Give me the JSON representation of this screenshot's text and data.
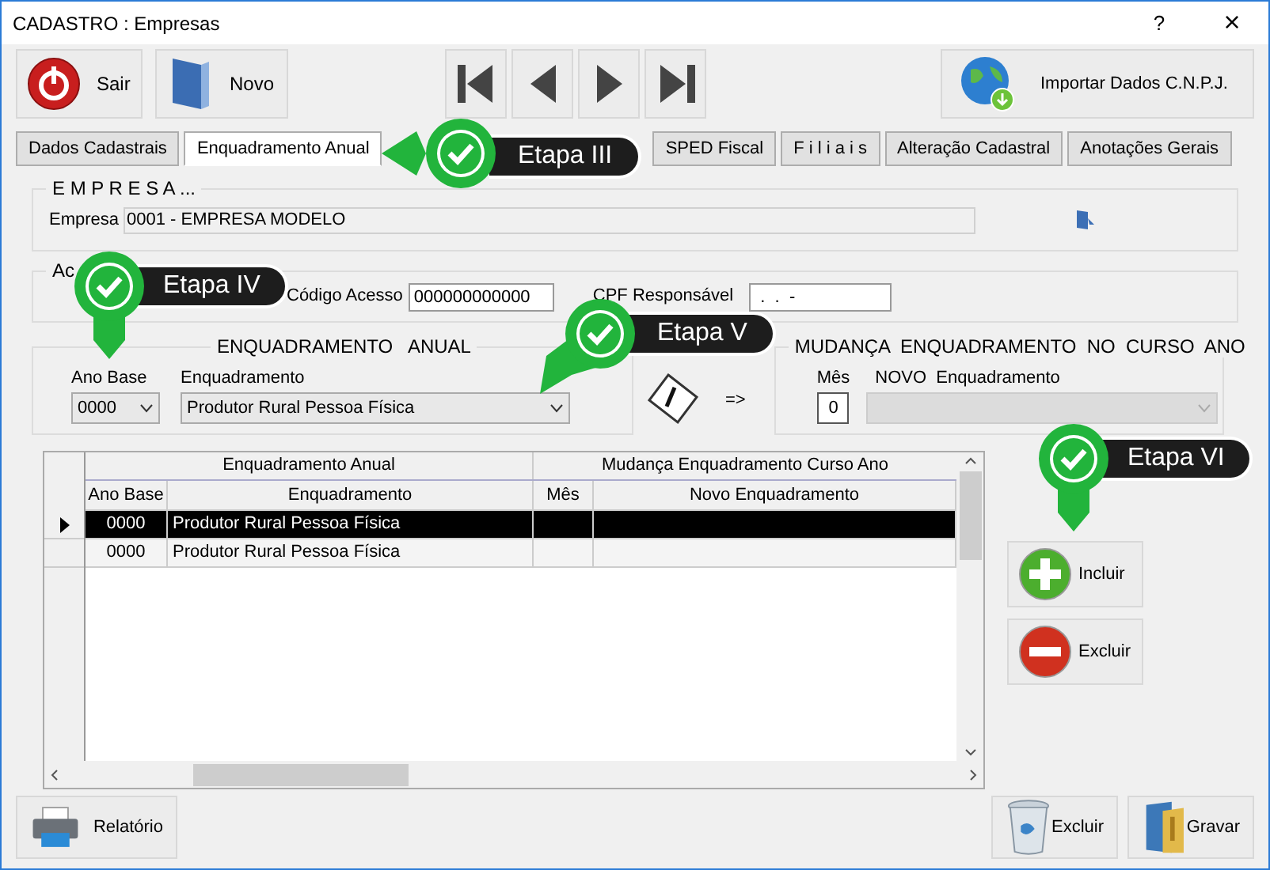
{
  "window": {
    "title": "CADASTRO : Empresas",
    "help": "?",
    "close": "×"
  },
  "toolbar": {
    "left": [
      {
        "label": "Sair",
        "kind": "power"
      },
      {
        "label": "Novo",
        "kind": "book"
      }
    ],
    "nav": [
      {
        "kind": "first"
      },
      {
        "kind": "prev"
      },
      {
        "kind": "next"
      },
      {
        "kind": "last"
      }
    ],
    "import": "Importar Dados C.N.P.J."
  },
  "tabs": [
    {
      "label": "Dados Cadastrais",
      "selected": false
    },
    {
      "label": "Enquadramento Anual",
      "selected": true
    },
    {
      "label": "SPED Fiscal",
      "selected": false
    },
    {
      "label": "F i l i a i s",
      "selected": false
    },
    {
      "label": "Alteração Cadastral",
      "selected": false
    },
    {
      "label": "Anotações Gerais",
      "selected": false
    }
  ],
  "empresa": {
    "legend": "E M P R E S A ...",
    "label": "Empresa",
    "value": "0001 - EMPRESA MODELO"
  },
  "acesso": {
    "legend": "Ac",
    "code_label": "Código Acesso",
    "code_value": "000000000000",
    "cpf_label": "CPF Responsável",
    "cpf_value": " .  .  -"
  },
  "enquadramento": {
    "legend": "ENQUADRAMENTO   ANUAL",
    "ano_label": "Ano Base",
    "ano_value": "0000",
    "enq_label": "Enquadramento",
    "enq_value": "Produtor Rural Pessoa Física",
    "arrow": "=>"
  },
  "mudanca": {
    "legend": "MUDANÇA  ENQUADRAMENTO  NO  CURSO  ANO",
    "mes_label": "Mês",
    "mes_value": "0",
    "novo_label": "NOVO  Enquadramento",
    "novo_disabled": true
  },
  "table": {
    "groups": [
      "Enquadramento Anual",
      "Mudança Enquadramento Curso Ano"
    ],
    "columns": [
      "Ano Base",
      "Enquadramento",
      "Mês",
      "Novo Enquadramento"
    ],
    "rows": [
      {
        "cells": [
          "0000",
          "Produtor Rural Pessoa Física",
          "",
          ""
        ],
        "selected": true
      },
      {
        "cells": [
          "0000",
          "Produtor Rural Pessoa Física",
          "",
          ""
        ],
        "selected": false
      }
    ]
  },
  "side_buttons": [
    {
      "label": "Incluir",
      "kind": "add"
    },
    {
      "label": "Excluir",
      "kind": "remove"
    }
  ],
  "bottom": {
    "left": "Relatório",
    "right": [
      {
        "label": "Excluir",
        "kind": "trash"
      },
      {
        "label": "Gravar",
        "kind": "folder"
      }
    ]
  },
  "callouts": [
    {
      "label": "Etapa III",
      "kind": "left"
    },
    {
      "label": "Etapa IV",
      "kind": "down"
    },
    {
      "label": "Etapa V",
      "kind": "downleft"
    },
    {
      "label": "Etapa VI",
      "kind": "down"
    }
  ]
}
